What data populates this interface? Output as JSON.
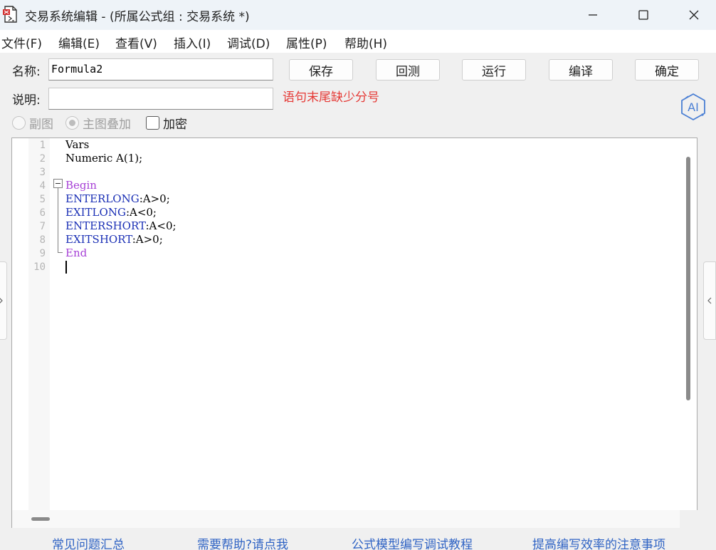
{
  "window": {
    "title": "交易系统编辑 - (所属公式组 : 交易系统 *)",
    "controls": [
      "minimize-icon",
      "maximize-icon",
      "close-icon"
    ]
  },
  "menu": {
    "items": [
      "文件(F)",
      "编辑(E)",
      "查看(V)",
      "插入(I)",
      "调试(D)",
      "属性(P)",
      "帮助(H)"
    ]
  },
  "form": {
    "name_label": "名称:",
    "name_value": "Formula2",
    "desc_label": "说明:",
    "desc_value": "",
    "error_message": "语句末尾缺少分号",
    "error_color": "#e53935"
  },
  "buttons": {
    "save": "保存",
    "backtest": "回测",
    "run": "运行",
    "compile": "编译",
    "confirm": "确定"
  },
  "ai_badge": {
    "label": "AI",
    "color": "#4a7fd4"
  },
  "options": {
    "sub_chart": "副图",
    "main_overlay": "主图叠加",
    "encrypt": "加密"
  },
  "editor": {
    "line_numbers": [
      "1",
      "2",
      "3",
      "4",
      "5",
      "6",
      "7",
      "8",
      "9",
      "10"
    ],
    "lines": {
      "l1": "Vars",
      "l2": "Numeric A(1);",
      "l4": "Begin",
      "l5_kw": "ENTERLONG",
      "l5_rest": ":A>0;",
      "l6_kw": "EXITLONG",
      "l6_rest": ":A<0;",
      "l7_kw": "ENTERSHORT",
      "l7_rest": ":A<0;",
      "l8_kw": "EXITSHORT",
      "l8_rest": ":A>0;",
      "l9": "End"
    },
    "keyword_color": "#a63fd6",
    "signal_color": "#1a2fb5"
  },
  "footer": {
    "links": [
      "常见问题汇总",
      "需要帮助?请点我",
      "公式模型编写调试教程",
      "提高编写效率的注意事项"
    ],
    "link_color": "#2f63c4"
  }
}
